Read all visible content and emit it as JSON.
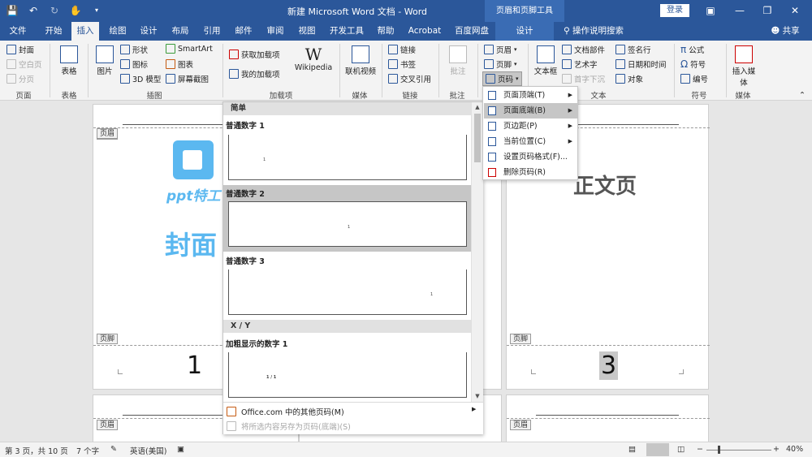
{
  "window": {
    "doc_title": "新建 Microsoft Word 文档 - Word",
    "context_title": "页眉和页脚工具",
    "login": "登录"
  },
  "tabs": [
    "文件",
    "开始",
    "插入",
    "绘图",
    "设计",
    "布局",
    "引用",
    "邮件",
    "审阅",
    "视图",
    "开发工具",
    "帮助",
    "Acrobat",
    "百度网盘",
    "设计"
  ],
  "tell_me": "操作说明搜索",
  "share": "共享",
  "ribbon": {
    "pages": {
      "cover": "封面",
      "blank": "空白页",
      "break": "分页",
      "label": "页面"
    },
    "tables": {
      "table": "表格",
      "label": "表格"
    },
    "illustrations": {
      "picture": "图片",
      "shapes": "形状",
      "icons": "图标",
      "model3d": "3D 模型",
      "smartart": "SmartArt",
      "chart": "图表",
      "screenshot": "屏幕截图",
      "label": "插图"
    },
    "addins": {
      "get": "获取加载项",
      "mine": "我的加载项",
      "wiki_glyph": "W",
      "wiki": "Wikipedia",
      "label": "加载项"
    },
    "media": {
      "video": "联机视频",
      "label": "媒体"
    },
    "links": {
      "link": "链接",
      "bookmark": "书签",
      "xref": "交叉引用",
      "label": "链接"
    },
    "comments": {
      "comment": "批注",
      "label": "批注"
    },
    "hf": {
      "header": "页眉",
      "footer": "页脚",
      "pagenum": "页码"
    },
    "text": {
      "textbox": "文本框",
      "parts": "文档部件",
      "wordart": "艺术字",
      "dropcap": "首字下沉",
      "signature": "签名行",
      "datetime": "日期和时间",
      "object": "对象",
      "label": "文本"
    },
    "symbols": {
      "equation": "公式",
      "symbol": "符号",
      "number": "编号",
      "label": "符号"
    },
    "embed": {
      "media": "插入媒体",
      "label": "媒体"
    }
  },
  "document": {
    "header_tag": "页眉",
    "footer_tag": "页脚",
    "logo_text": "ppt特工",
    "cover_text": "封面",
    "body_text": "正文页",
    "page1_number": "1",
    "page3_number": "3"
  },
  "gallery": {
    "sections": [
      "简单",
      "X / Y"
    ],
    "items": [
      {
        "name": "普通数字 1",
        "num": "1"
      },
      {
        "name": "普通数字 2",
        "num": "1"
      },
      {
        "name": "普通数字 3",
        "num": "1"
      },
      {
        "name": "加粗显示的数字 1",
        "num": "1 / 1"
      }
    ],
    "footer": [
      {
        "label": "Office.com 中的其他页码(M)",
        "disabled": false
      },
      {
        "label": "将所选内容另存为页码(底端)(S)",
        "disabled": true
      }
    ]
  },
  "context_menu": [
    {
      "label": "页面顶端(T)",
      "arrow": true
    },
    {
      "label": "页面底端(B)",
      "arrow": true
    },
    {
      "label": "页边距(P)",
      "arrow": true
    },
    {
      "label": "当前位置(C)",
      "arrow": true
    },
    {
      "label": "设置页码格式(F)...",
      "arrow": false
    },
    {
      "label": "删除页码(R)",
      "arrow": false
    }
  ],
  "status": {
    "page": "第 3 页，共 10 页",
    "words": "7 个字",
    "lang": "英语(美国)",
    "zoom": "40%"
  },
  "colors": {
    "brand": "#2b579a",
    "logo": "#5bb8f0",
    "highlight": "#c6c6c6"
  }
}
